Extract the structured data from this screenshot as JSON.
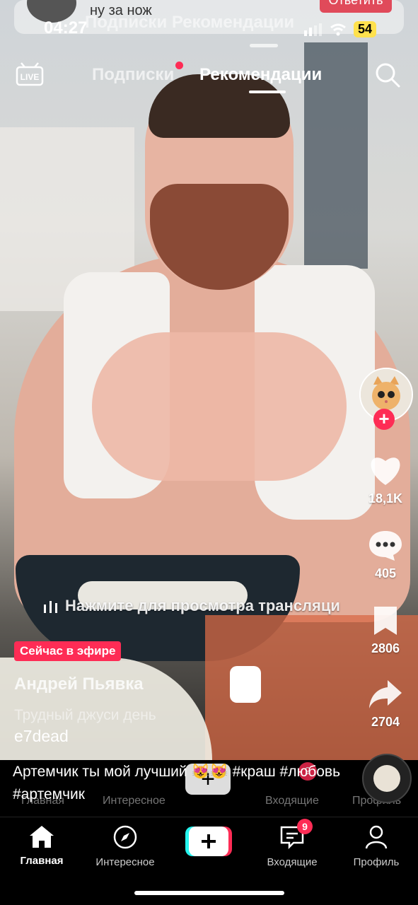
{
  "status": {
    "time": "04:27",
    "battery": "54"
  },
  "ghost_notification": {
    "message": "ну за нож",
    "reply_label": "Ответить",
    "tabs_text": "Подписки   Рекомендации"
  },
  "top_nav": {
    "live_label": "LIVE",
    "tab_following": "Подписки",
    "tab_for_you": "Рекомендации"
  },
  "sidebar": {
    "likes": "18,1K",
    "comments": "405",
    "saves": "2806",
    "shares": "2704"
  },
  "live": {
    "hint": "Нажмите для просмотра трансляци",
    "badge": "Сейчас в эфире",
    "author": "Андрей Пьявка",
    "subtitle": "Трудный джуси день"
  },
  "video": {
    "handle": "e7dead",
    "caption": "Артемчик ты мой лучший 😻😻 #краш #любовь #артемчик"
  },
  "bottom_nav": {
    "home": "Главная",
    "discover": "Интересное",
    "inbox": "Входящие",
    "inbox_badge": "9",
    "profile": "Профиль"
  },
  "icons": [
    "live-icon",
    "search-icon",
    "heart-icon",
    "comment-icon",
    "bookmark-icon",
    "share-icon",
    "home-icon",
    "compass-icon",
    "plus-icon",
    "inbox-icon",
    "profile-icon"
  ],
  "colors": {
    "accent": "#fe2c55",
    "battery": "#ffe14d"
  }
}
